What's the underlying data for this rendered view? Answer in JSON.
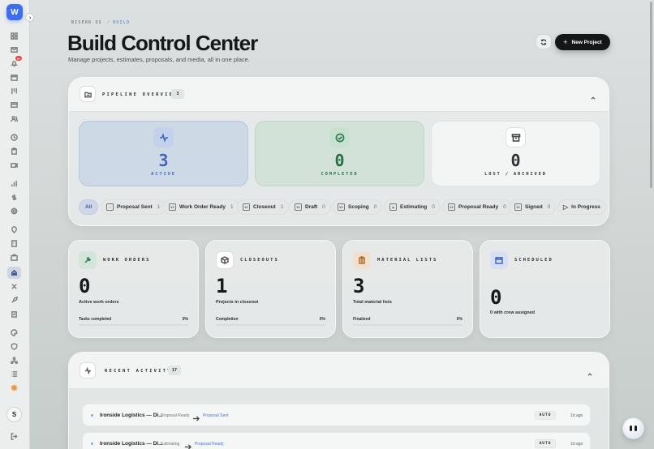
{
  "sidebar": {
    "logo_letter": "W",
    "notification_badge": "9+",
    "avatar_letter": "S",
    "icons": [
      "grid-icon",
      "mail-icon",
      "bell-icon",
      "calendar-icon",
      "board-icon",
      "card-icon",
      "users-icon",
      "clock-icon",
      "clipboard-icon",
      "video-icon",
      "chart-icon",
      "dollar-icon",
      "gear-icon",
      "pin-icon",
      "building-icon",
      "briefcase-icon",
      "build-icon",
      "tools-icon",
      "rocket-icon",
      "checklist-icon",
      "palette-icon",
      "shield-icon",
      "network-icon",
      "list-icon",
      "sun-icon",
      "logout-icon"
    ],
    "active_item": "build-icon"
  },
  "breadcrumb": {
    "root": "BISERR OS",
    "separator": "/",
    "current": "BUILD"
  },
  "header": {
    "title": "Build Control Center",
    "subtitle": "Manage projects, estimates, proposals, and media, all in one place.",
    "new_project_label": "New Project"
  },
  "pipeline": {
    "title": "PIPELINE OVERVIEW",
    "count": "3",
    "summary": [
      {
        "value": "3",
        "label": "ACTIVE"
      },
      {
        "value": "0",
        "label": "COMPLETED"
      },
      {
        "value": "0",
        "label": "LOST / ARCHIVED"
      }
    ],
    "filters": [
      {
        "label": "All",
        "count": ""
      },
      {
        "label": "Proposal Sent",
        "count": "1"
      },
      {
        "label": "Work Order Ready",
        "count": "1"
      },
      {
        "label": "Closeout",
        "count": "1"
      },
      {
        "label": "Draft",
        "count": "0"
      },
      {
        "label": "Scoping",
        "count": "0"
      },
      {
        "label": "Estimating",
        "count": "0"
      },
      {
        "label": "Proposal Ready",
        "count": "0"
      },
      {
        "label": "Signed",
        "count": "0"
      },
      {
        "label": "In Progress",
        "count": ""
      }
    ]
  },
  "stats": [
    {
      "title": "WORK ORDERS",
      "value": "0",
      "sub": "Active work orders",
      "progress_label": "Tasks completed",
      "percent": "0%",
      "progress": 0
    },
    {
      "title": "CLOSEOUTS",
      "value": "1",
      "sub": "Projects in closeout",
      "progress_label": "Completion",
      "percent": "0%",
      "progress": 0
    },
    {
      "title": "MATERIAL LISTS",
      "value": "3",
      "sub": "Total material lists",
      "progress_label": "Finalized",
      "percent": "0%",
      "progress": 0
    },
    {
      "title": "SCHEDULED",
      "value": "0",
      "sub": "0 with crew assigned"
    }
  ],
  "activity": {
    "title": "RECENT ACTIVITY",
    "count": "17",
    "rows": [
      {
        "name": "Ironside Logistics — Di...",
        "from": "Proposal Ready",
        "to": "Proposal Sent",
        "tag": "AUTO",
        "time": "1d ago"
      },
      {
        "name": "Ironside Logistics — Di...",
        "from": "Estimating",
        "to": "Proposal Ready",
        "tag": "AUTO",
        "time": "1d ago"
      }
    ]
  },
  "colors": {
    "accent": "#4a73d8",
    "primary_button": "#141618",
    "active": "#4467bb",
    "completed": "#2b6f47"
  }
}
